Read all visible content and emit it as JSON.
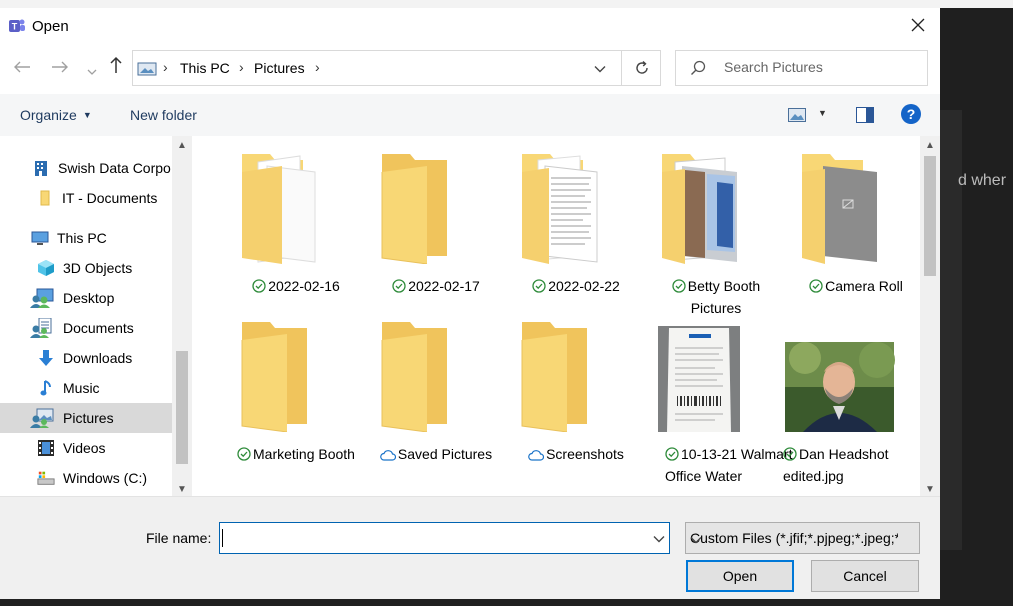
{
  "window": {
    "title": "Open"
  },
  "background": {
    "partial_text": "d wher"
  },
  "address_bar": {
    "crumbs": [
      "This PC",
      "Pictures"
    ]
  },
  "search": {
    "placeholder": "Search Pictures"
  },
  "toolbar": {
    "organize_label": "Organize",
    "new_folder_label": "New folder",
    "help_label": "?"
  },
  "nav_pane": {
    "items": [
      {
        "label": "Swish Data Corpo",
        "icon": "building-icon"
      },
      {
        "label": "IT - Documents",
        "icon": "folder-icon"
      },
      {
        "label": "This PC",
        "icon": "computer-icon"
      },
      {
        "label": "3D Objects",
        "icon": "cube-icon"
      },
      {
        "label": "Desktop",
        "icon": "desktop-icon"
      },
      {
        "label": "Documents",
        "icon": "documents-icon"
      },
      {
        "label": "Downloads",
        "icon": "download-arrow-icon"
      },
      {
        "label": "Music",
        "icon": "music-note-icon"
      },
      {
        "label": "Pictures",
        "icon": "pictures-icon",
        "selected": true
      },
      {
        "label": "Videos",
        "icon": "video-film-icon"
      },
      {
        "label": "Windows (C:)",
        "icon": "drive-icon"
      }
    ]
  },
  "files": [
    {
      "name": "2022-02-16",
      "status": "synced",
      "type": "folder-docs"
    },
    {
      "name": "2022-02-17",
      "status": "synced",
      "type": "folder"
    },
    {
      "name": "2022-02-22",
      "status": "synced",
      "type": "folder-text"
    },
    {
      "name": "Betty Booth Pictures",
      "status": "synced",
      "type": "folder-photo"
    },
    {
      "name": "Camera Roll",
      "status": "synced",
      "type": "folder-gray"
    },
    {
      "name": "Marketing Booth",
      "status": "synced",
      "type": "folder"
    },
    {
      "name": "Saved Pictures",
      "status": "cloud",
      "type": "folder"
    },
    {
      "name": "Screenshots",
      "status": "cloud",
      "type": "folder"
    },
    {
      "name": "10-13-21 Walmart Office Water",
      "status": "synced",
      "type": "receipt-image"
    },
    {
      "name": "Dan Headshot edited.jpg",
      "status": "synced",
      "type": "portrait-image"
    }
  ],
  "bottom": {
    "file_name_label": "File name:",
    "file_name_value": "",
    "filter_value": "Custom Files (*.jfif;*.pjpeg;*.jpeg;*.pjp;*.jpg;*.png)",
    "open_label": "Open",
    "cancel_label": "Cancel"
  },
  "colors": {
    "accent": "#0078d7",
    "folder": "#f8d775",
    "synced": "#2e8b3a",
    "cloud": "#1a73c8"
  }
}
